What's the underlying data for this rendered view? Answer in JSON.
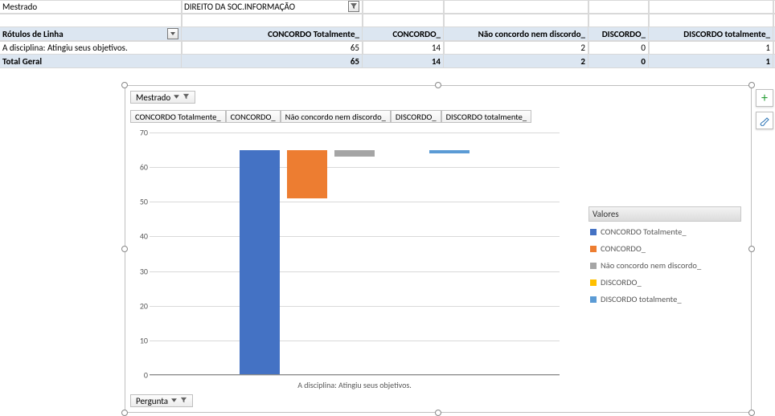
{
  "header": {
    "a1": "Mestrado",
    "b1": "DIREITO DA SOC.INFORMAÇÃO"
  },
  "pivot": {
    "row_label_header": "Rótulos de Linha",
    "cols": [
      "CONCORDO Totalmente_",
      "CONCORDO_",
      "Não concordo nem discordo_",
      "DISCORDO_",
      "DISCORDO totalmente_"
    ],
    "row1": {
      "label": "A disciplina: Atingiu seus objetivos.",
      "vals": [
        "65",
        "14",
        "2",
        "0",
        "1"
      ]
    },
    "total": {
      "label": "Total Geral",
      "vals": [
        "65",
        "14",
        "2",
        "0",
        "1"
      ]
    }
  },
  "chart_controls": {
    "filter1": "Mestrado",
    "filter2": "Pergunta",
    "series_buttons": [
      "CONCORDO Totalmente_",
      "CONCORDO_",
      "Não concordo nem discordo_",
      "DISCORDO_",
      "DISCORDO totalmente_"
    ]
  },
  "legend": {
    "title": "Valores",
    "items": [
      "CONCORDO Totalmente_",
      "CONCORDO_",
      "Não concordo nem discordo_",
      "DISCORDO_",
      "DISCORDO totalmente_"
    ]
  },
  "colors": {
    "series": [
      "#4472c4",
      "#ed7d31",
      "#a5a5a5",
      "#ffc000",
      "#5b9bd5"
    ]
  },
  "chart_data": {
    "type": "bar",
    "categories": [
      "A disciplina: Atingiu seus objetivos."
    ],
    "series": [
      {
        "name": "CONCORDO Totalmente_",
        "values": [
          65
        ]
      },
      {
        "name": "CONCORDO_",
        "values": [
          14
        ]
      },
      {
        "name": "Não concordo nem discordo_",
        "values": [
          2
        ]
      },
      {
        "name": "DISCORDO_",
        "values": [
          0
        ]
      },
      {
        "name": "DISCORDO totalmente_",
        "values": [
          1
        ]
      }
    ],
    "ylabel": "",
    "xlabel": "",
    "ylim": [
      0,
      70
    ],
    "yticks": [
      0,
      10,
      20,
      30,
      40,
      50,
      60,
      70
    ],
    "title": "",
    "legend_title": "Valores"
  }
}
